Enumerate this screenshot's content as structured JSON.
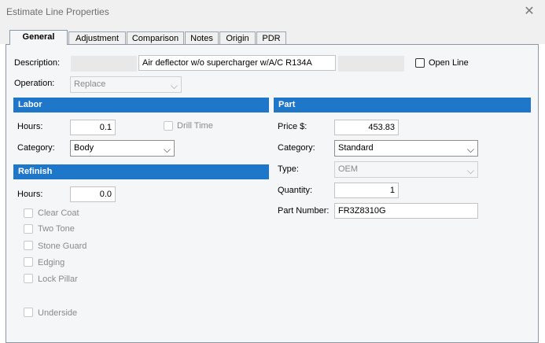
{
  "window": {
    "title": "Estimate Line Properties",
    "close_glyph": "✕"
  },
  "tabs": [
    {
      "label": "General"
    },
    {
      "label": "Adjustment"
    },
    {
      "label": "Comparison"
    },
    {
      "label": "Notes"
    },
    {
      "label": "Origin"
    },
    {
      "label": "PDR"
    }
  ],
  "active_tab": "General",
  "general": {
    "description_label": "Description:",
    "description_value": "Air deflector w/o supercharger w/A/C R134A",
    "open_line_label": "Open Line",
    "open_line_checked": false,
    "operation_label": "Operation:",
    "operation_value": "Replace"
  },
  "labor": {
    "title": "Labor",
    "hours_label": "Hours:",
    "hours_value": "0.1",
    "drill_time_label": "Drill Time",
    "drill_time_checked": false,
    "category_label": "Category:",
    "category_value": "Body"
  },
  "refinish": {
    "title": "Refinish",
    "hours_label": "Hours:",
    "hours_value": "0.0",
    "options": [
      "Clear Coat",
      "Two Tone",
      "Stone Guard",
      "Edging",
      "Lock Pillar"
    ],
    "underside_label": "Underside"
  },
  "part": {
    "title": "Part",
    "price_label": "Price $:",
    "price_value": "453.83",
    "category_label": "Category:",
    "category_value": "Standard",
    "type_label": "Type:",
    "type_value": "OEM",
    "quantity_label": "Quantity:",
    "quantity_value": "1",
    "part_number_label": "Part Number:",
    "part_number_value": "FR3Z8310G"
  },
  "icons": {
    "dropdown": "chevron-down-icon",
    "close": "close-icon",
    "checkbox": "checkbox-icon"
  },
  "colors": {
    "section_header": "#1f77c9",
    "panel_bg": "#f4f6f8",
    "titlebar_bg": "#f0f0f0"
  }
}
